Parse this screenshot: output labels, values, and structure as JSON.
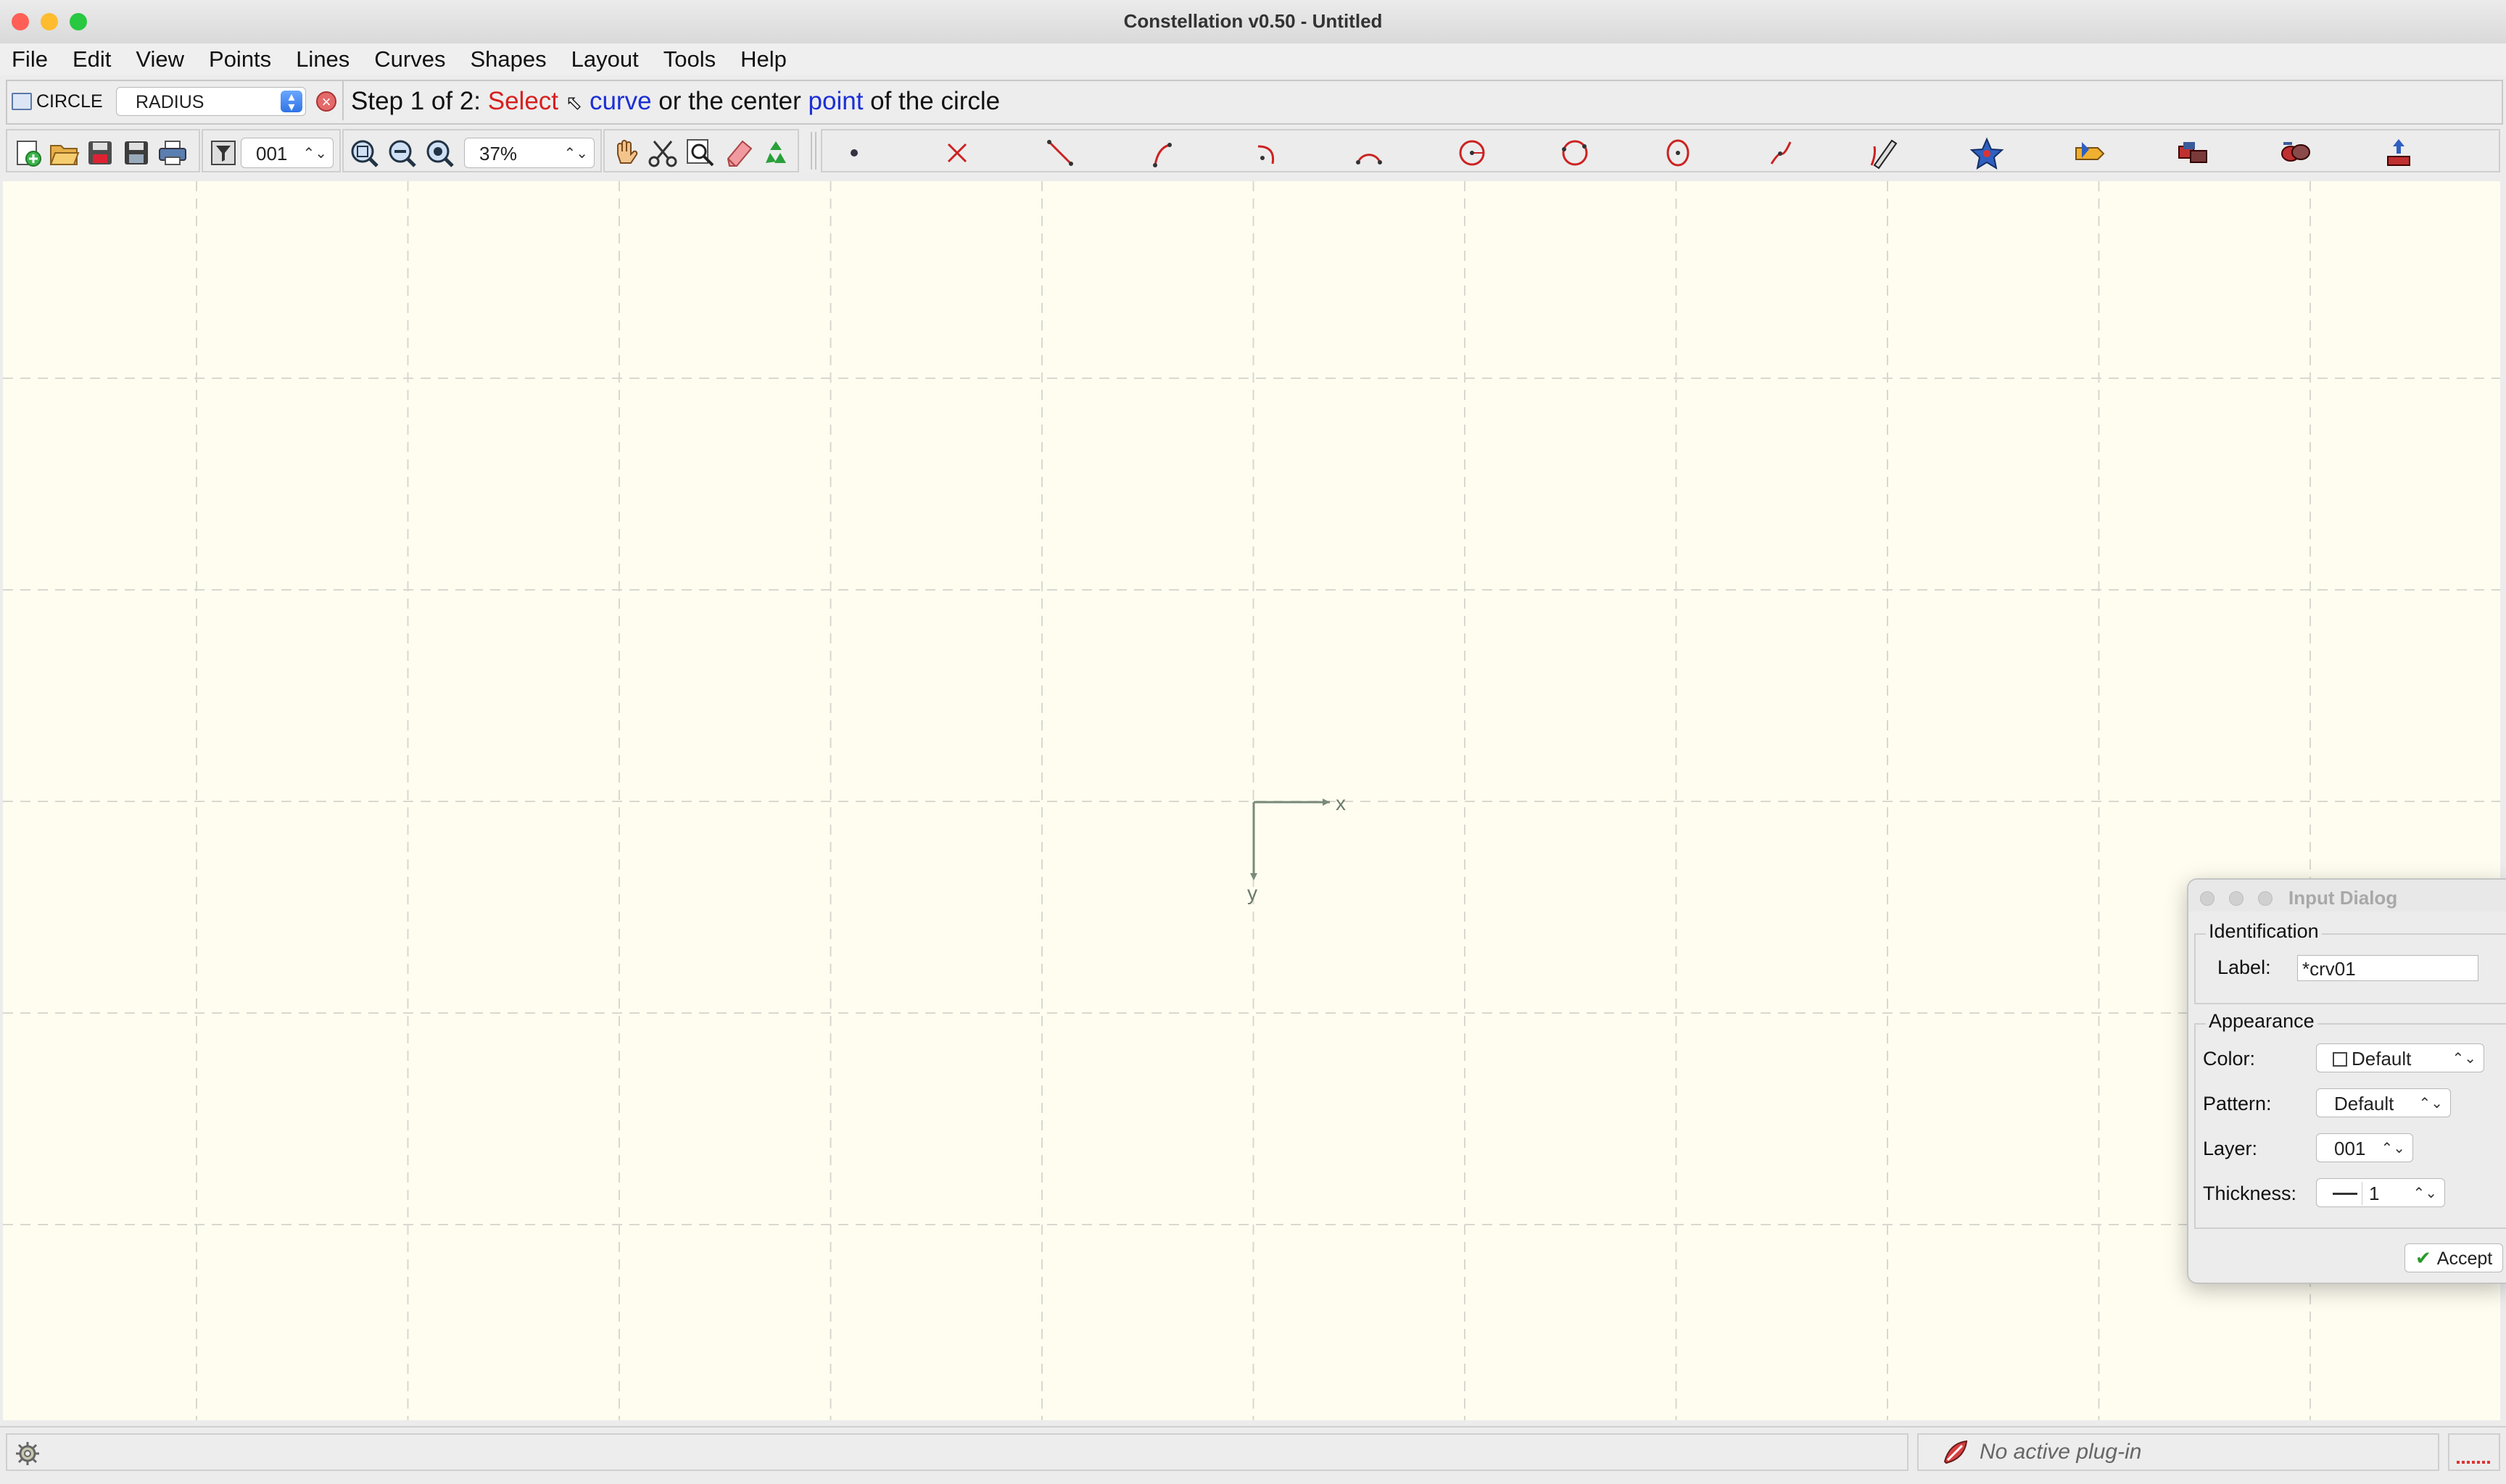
{
  "window": {
    "title": "Constellation v0.50 - Untitled"
  },
  "menu": [
    "File",
    "Edit",
    "View",
    "Points",
    "Lines",
    "Curves",
    "Shapes",
    "Layout",
    "Tools",
    "Help"
  ],
  "mode_bar": {
    "mode": "CIRCLE",
    "method": "RADIUS",
    "prompt": {
      "step": "Step 1 of 2: ",
      "select": "Select",
      "curve": "curve",
      "or_the_center": " or the center ",
      "point": "point",
      "of_the_circle": " of the circle"
    },
    "colors": {
      "select": "#d72020",
      "keyword": "#1b2fd6"
    }
  },
  "toolbar": {
    "file_icons": [
      "new-document-icon",
      "open-folder-icon",
      "save-as-icon",
      "save-icon",
      "print-icon"
    ],
    "layer_value": "001",
    "zoom_value": "37%",
    "zoom_icons": [
      "zoom-fit-icon",
      "zoom-out-icon",
      "zoom-window-icon"
    ],
    "tool_icons": [
      "pan-hand-icon",
      "scissors-icon",
      "magnifier-icon",
      "eraser-icon",
      "recycle-icon"
    ],
    "shape_tools": [
      "point",
      "intersection",
      "line",
      "arc-3-point",
      "arc-center",
      "arc-180",
      "circle-radius",
      "circle-3-point",
      "circle-center",
      "spline",
      "freehand",
      "star",
      "burst",
      "group",
      "ungroup",
      "transform"
    ]
  },
  "canvas": {
    "background": "#fffdf0",
    "grid_color": "#d8d8d0",
    "axis_x_label": "x",
    "axis_y_label": "y"
  },
  "dialog": {
    "title": "Input Dialog",
    "identification": {
      "legend": "Identification",
      "label_caption": "Label:",
      "label_value": "*crv01"
    },
    "appearance": {
      "legend": "Appearance",
      "color_caption": "Color:",
      "color_value": "Default",
      "pattern_caption": "Pattern:",
      "pattern_value": "Default",
      "layer_caption": "Layer:",
      "layer_value": "001",
      "thickness_caption": "Thickness:",
      "thickness_value": "1"
    },
    "accept_label": "Accept"
  },
  "status": {
    "plugin_text": "No active plug-in"
  }
}
